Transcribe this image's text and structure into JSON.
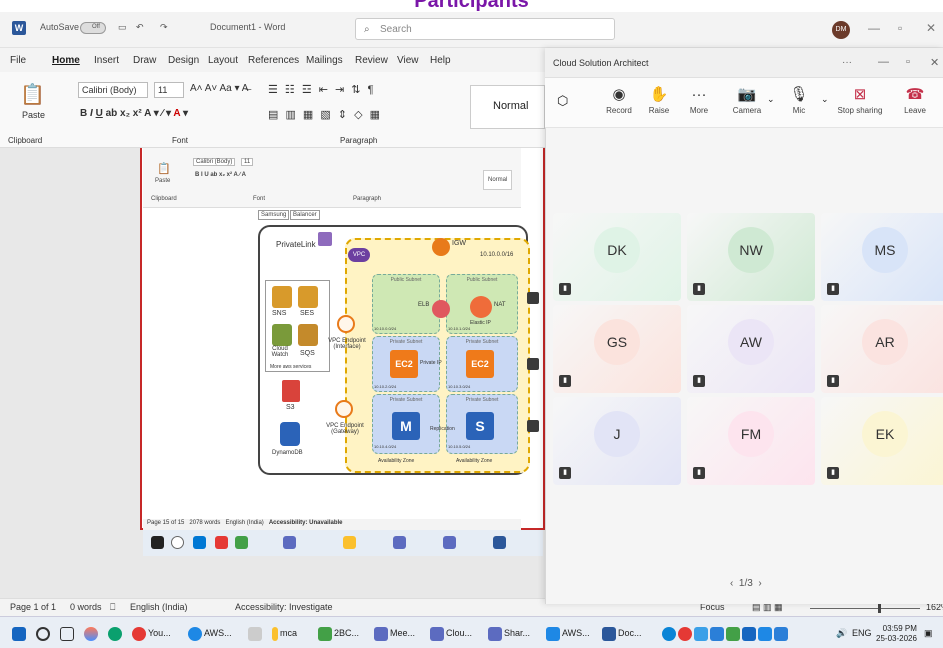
{
  "banner": {
    "title": "Participants"
  },
  "word": {
    "titlebar": {
      "autosave": "AutoSave",
      "toggle": "Off",
      "doc_title": "Document1 - Word",
      "search_placeholder": "Search",
      "user_initials": "DM"
    },
    "menu": [
      "File",
      "Home",
      "Insert",
      "Draw",
      "Design",
      "Layout",
      "References",
      "Mailings",
      "Review",
      "View",
      "Help"
    ],
    "ribbon": {
      "paste": "Paste",
      "clipboard": "Clipboard",
      "font_name": "Calibri (Body)",
      "font_size": "11",
      "font_group": "Font",
      "paragraph_group": "Paragraph",
      "style_normal": "Normal"
    },
    "statusbar": {
      "page": "Page 1 of 1",
      "words": "0 words",
      "language": "English (India)",
      "accessibility": "Accessibility: Investigate",
      "focus": "Focus",
      "zoom": "162%"
    }
  },
  "shared_screen": {
    "ribbon": {
      "font_name": "Calibri (Body)",
      "font_size": "11",
      "font": "Font",
      "paragraph": "Paragraph",
      "clipboard": "Clipboard",
      "style": "Normal",
      "paste": "Paste",
      "chips": [
        "Samsung",
        "Balancer"
      ]
    },
    "diagram": {
      "privatelink": "PrivateLink",
      "igw": "IGW",
      "cidr": "10.10.0.0/16",
      "vpc": "VPC",
      "services": [
        "SNS",
        "SES",
        "Cloud Watch",
        "SQS"
      ],
      "more_services": "More aws services",
      "s3": "S3",
      "dynamodb": "DynamoDB",
      "endpoint_interface": "VPC Endpoint (Interface)",
      "endpoint_gateway": "VPC Endpoint (Gateway)",
      "public_subnet": "Public Subnet",
      "private_subnet": "Private Subnet",
      "elb": "ELB",
      "nat": "NAT",
      "elastic_ip": "Elastic IP",
      "ec2": "EC2",
      "private_ip": "Private IP",
      "db_master": "M",
      "db_standby": "S",
      "replication": "Replication",
      "availability_zone": "Availability Zone",
      "subnet_cidrs": [
        "10.10.0.0/24",
        "10.10.1.0/24",
        "10.10.2.0/24",
        "10.10.3.0/24",
        "10.10.4.0/24",
        "10.10.5.0/24"
      ]
    },
    "status": {
      "page": "Page 15 of 15",
      "words": "2078 words",
      "language": "English (India)",
      "accessibility": "Accessibility: Unavailable"
    }
  },
  "teams": {
    "window_title": "Cloud Solution Architect",
    "controls": [
      {
        "label": "Record",
        "icon": "record-icon"
      },
      {
        "label": "Raise",
        "icon": "hand-icon"
      },
      {
        "label": "More",
        "icon": "more-icon"
      },
      {
        "label": "Camera",
        "icon": "camera-off-icon"
      },
      {
        "label": "Mic",
        "icon": "mic-icon"
      },
      {
        "label": "Stop sharing",
        "icon": "stop-share-icon"
      },
      {
        "label": "Leave",
        "icon": "leave-icon"
      }
    ],
    "participants": [
      {
        "initials": "DK",
        "color": "#dff3e6"
      },
      {
        "initials": "NW",
        "color": "#cfe9d3"
      },
      {
        "initials": "MS",
        "color": "#d8e4f8"
      },
      {
        "initials": "GS",
        "color": "#fbe3dd"
      },
      {
        "initials": "AW",
        "color": "#ebe5f6"
      },
      {
        "initials": "AR",
        "color": "#fbe3e0"
      },
      {
        "initials": "J",
        "color": "#e2e4f6"
      },
      {
        "initials": "FM",
        "color": "#fde4ee"
      },
      {
        "initials": "EK",
        "color": "#fbf5d3"
      }
    ],
    "pager": "1/3"
  },
  "taskbar": {
    "items": [
      {
        "label": "You...",
        "color": "#e53935"
      },
      {
        "label": "AWS...",
        "color": "#1e88e5"
      },
      {
        "label": "mca",
        "color": "#fbc02d"
      },
      {
        "label": "2BC...",
        "color": "#43a047"
      },
      {
        "label": "Mee...",
        "color": "#5c6bc0"
      },
      {
        "label": "Clou...",
        "color": "#5c6bc0"
      },
      {
        "label": "Shar...",
        "color": "#5c6bc0"
      },
      {
        "label": "AWS...",
        "color": "#1e88e5"
      },
      {
        "label": "Doc...",
        "color": "#2b579a"
      }
    ],
    "lang": "ENG",
    "time": "03:59 PM",
    "date": "25-03-2026"
  }
}
